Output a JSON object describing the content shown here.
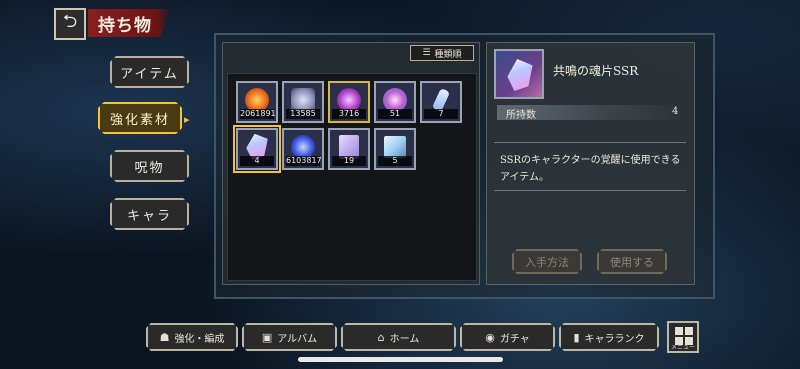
{
  "header": {
    "back_glyph": "⮌",
    "title": "持ち物"
  },
  "side_menu": {
    "items": [
      {
        "label": "アイテム"
      },
      {
        "label": "強化素材"
      },
      {
        "label": "呪物"
      },
      {
        "label": "キャラ"
      }
    ],
    "active_indicator": "▸"
  },
  "grid": {
    "sort_label": "種類順",
    "sort_icon": "☰",
    "items": [
      {
        "count": "2061891",
        "icon": "flame-orb-icon",
        "color": "#e86a20"
      },
      {
        "count": "13585",
        "icon": "crystal-cluster-icon",
        "color": "#8a8fb8"
      },
      {
        "count": "3716",
        "icon": "purple-burst-icon",
        "color": "#b040c8"
      },
      {
        "count": "51",
        "icon": "star-crystal-icon",
        "color": "#c060d0"
      },
      {
        "count": "7",
        "icon": "feather-shard-icon",
        "color": "#8db4e8"
      },
      {
        "count": "4",
        "icon": "soul-shard-icon",
        "color": "#d7c6ff"
      },
      {
        "count": "6103817",
        "icon": "blue-orb-icon",
        "color": "#3b55e0"
      },
      {
        "count": "19",
        "icon": "scroll-card-icon",
        "color": "#9b7fd8"
      },
      {
        "count": "5",
        "icon": "crystal-stack-icon",
        "color": "#9fd0f0"
      }
    ]
  },
  "detail": {
    "name": "共鳴の魂片SSR",
    "held_label": "所持数",
    "held_value": "4",
    "description": "SSRのキャラクターの覚醒に使用できるアイテム。",
    "obtain_label": "入手方法",
    "use_label": "使用する"
  },
  "bottom_nav": {
    "items": [
      {
        "label": "強化・編成",
        "icon": "☗"
      },
      {
        "label": "アルバム",
        "icon": "▣"
      },
      {
        "label": "ホーム",
        "icon": "⌂"
      },
      {
        "label": "ガチャ",
        "icon": "◉"
      },
      {
        "label": "キャラランク",
        "icon": "▮"
      }
    ],
    "menu_label": "メニュー"
  }
}
